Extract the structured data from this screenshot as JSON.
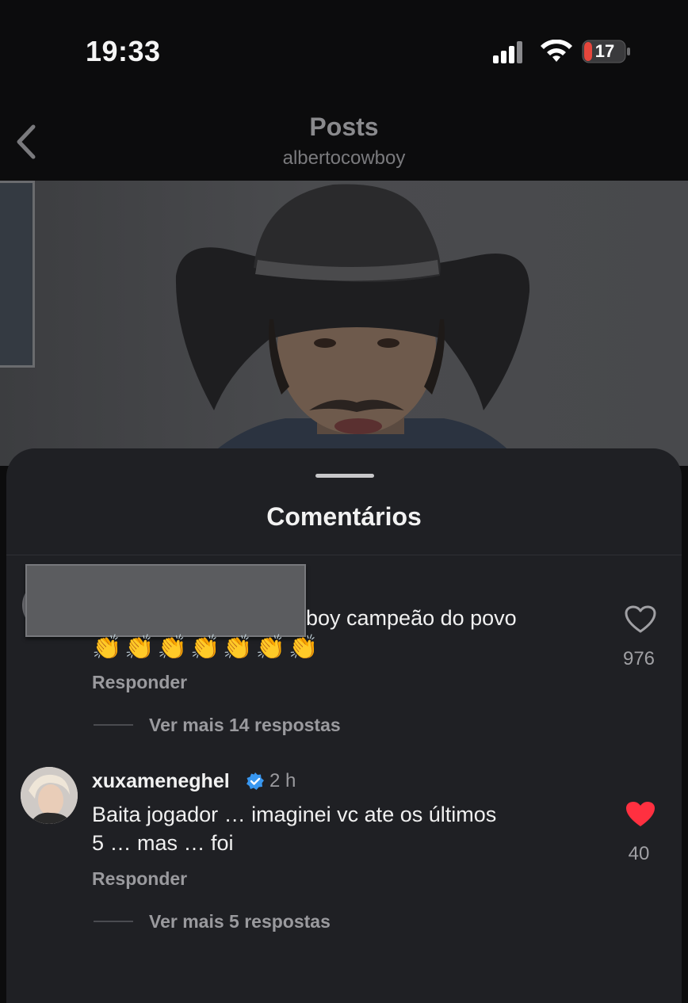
{
  "status_bar": {
    "time": "19:33",
    "battery": "17",
    "battery_color": "#e5463c"
  },
  "header": {
    "title": "Posts",
    "username": "albertocowboy"
  },
  "sheet": {
    "title": "Comentários"
  },
  "comments": [
    {
      "text": "boy campeão do povo",
      "emojis": "👏👏👏👏👏👏👏",
      "reply_label": "Responder",
      "more_replies": "Ver mais 14 respostas",
      "likes": "976",
      "liked": false
    },
    {
      "username": "xuxameneghel",
      "verified": true,
      "time": "2 h",
      "text_line1": "Baita jogador … imaginei vc ate os  últimos",
      "text_line2": "5 … mas … foi",
      "reply_label": "Responder",
      "more_replies": "Ver mais 5 respostas",
      "likes": "40",
      "liked": true,
      "heart_color": "#ff3040"
    }
  ],
  "icons": [
    "back-chevron-icon",
    "signal-icon",
    "wifi-icon",
    "battery-icon",
    "heart-outline-icon",
    "heart-filled-icon",
    "verified-badge-icon"
  ]
}
